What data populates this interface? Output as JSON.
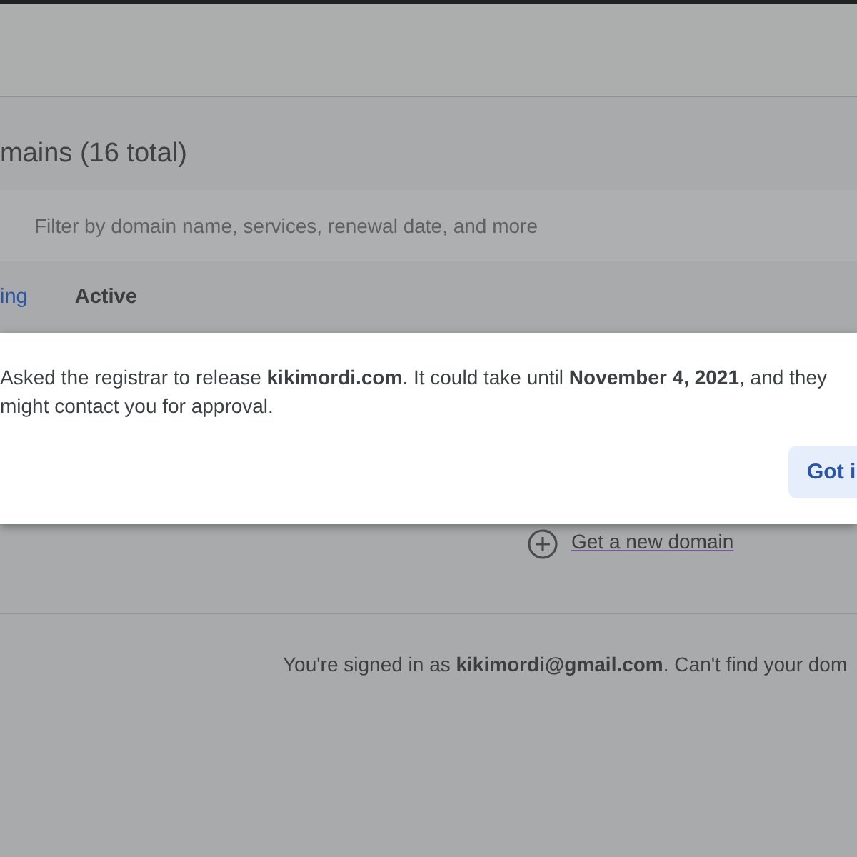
{
  "header": {
    "title": "mains (16 total)"
  },
  "search": {
    "placeholder": "Filter by domain name, services, renewal date, and more"
  },
  "tabs": [
    {
      "label": "ing",
      "selected": true
    },
    {
      "label": "Active",
      "selected": false
    }
  ],
  "dialog": {
    "message": "Asked the registrar to release **kikimordi.com**. It could take until **November 4, 2021**, and they might contact you for approval.",
    "button": "Got i"
  },
  "new_domain_link": "Get a new domain",
  "footer": "You're signed in as **kikimordi@gmail.com**. Can't find your dom"
}
